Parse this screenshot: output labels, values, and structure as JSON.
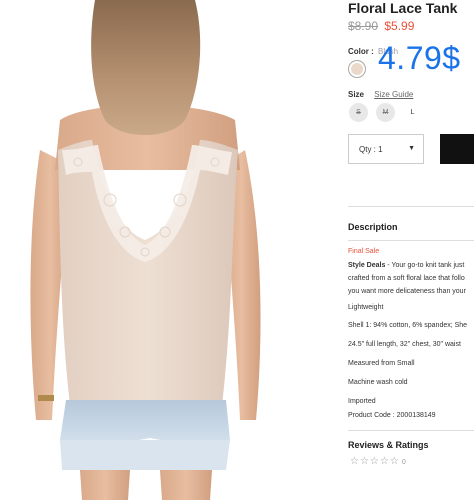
{
  "product": {
    "title": "Floral Lace Tank",
    "original_price": "$8.90",
    "sale_price": "$5.99",
    "overlay_price": "4.79$"
  },
  "color": {
    "label": "Color :",
    "selected": "Blush",
    "swatch_hex": "#ead9ca"
  },
  "size": {
    "label": "Size",
    "guide_link": "Size Guide",
    "options": [
      "S",
      "M",
      "L"
    ],
    "unavailable": [
      "S",
      "M"
    ]
  },
  "quantity": {
    "label": "Qty : 1"
  },
  "description": {
    "heading": "Description",
    "final_sale": "Final Sale",
    "style_deals_label": "Style Deals",
    "style_deals_text": " - Your go-to knit tank just",
    "line2": "crafted from a soft floral lace that follo",
    "line3": "you want more delicateness than your",
    "lightweight": "Lightweight",
    "content": "Shell 1: 94% cotton, 6% spandex; She",
    "measurements": "24.5\" full length, 32\" chest, 30\" waist",
    "measured_from": "Measured from Small",
    "care": "Machine wash cold",
    "origin": "Imported",
    "product_code": "Product Code : 2000138149"
  },
  "reviews": {
    "heading": "Reviews & Ratings",
    "stars": "☆☆☆☆☆",
    "count": "0"
  },
  "colors": {
    "sale_red": "#e8513a",
    "overlay_blue": "#1a73e8",
    "button_black": "#111111"
  }
}
